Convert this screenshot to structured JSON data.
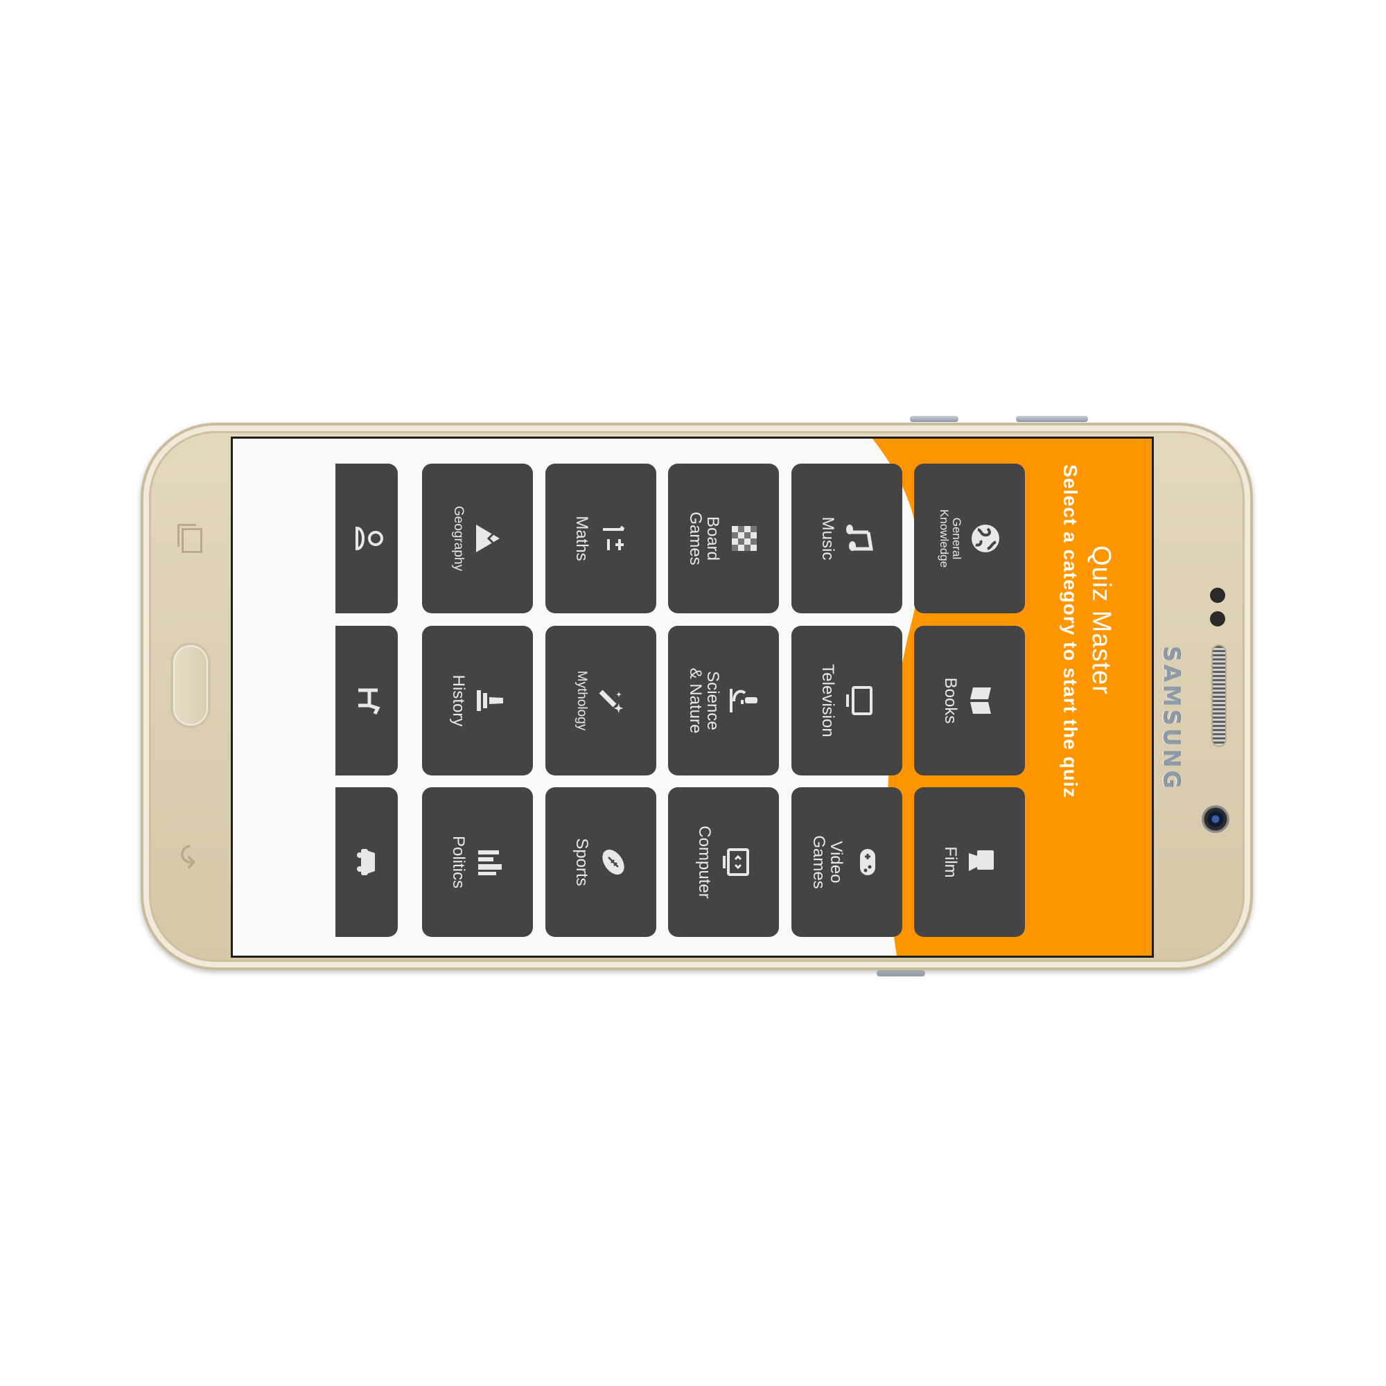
{
  "device": {
    "brand": "SAMSUNG",
    "body_color": "#dccfb2"
  },
  "app": {
    "title": "Quiz Master",
    "subtitle": "Select a category to start the quiz",
    "accent_color": "#ff9500",
    "tile_color": "#444444"
  },
  "categories": [
    {
      "label": "General\nKnowledge",
      "icon": "globe-icon"
    },
    {
      "label": "Books",
      "icon": "book-icon"
    },
    {
      "label": "Film",
      "icon": "film-camera-icon"
    },
    {
      "label": "Music",
      "icon": "music-note-icon"
    },
    {
      "label": "Television",
      "icon": "tv-icon"
    },
    {
      "label": "Video\nGames",
      "icon": "gamepad-icon"
    },
    {
      "label": "Board\nGames",
      "icon": "chessboard-icon"
    },
    {
      "label": "Science\n& Nature",
      "icon": "microscope-icon"
    },
    {
      "label": "Computer",
      "icon": "computer-icon"
    },
    {
      "label": "Maths",
      "icon": "numbers-icon"
    },
    {
      "label": "Mythology",
      "icon": "magic-wand-icon"
    },
    {
      "label": "Sports",
      "icon": "football-icon"
    },
    {
      "label": "Geography",
      "icon": "mountain-icon"
    },
    {
      "label": "History",
      "icon": "monument-icon"
    },
    {
      "label": "Politics",
      "icon": "parliament-icon"
    },
    {
      "label": "",
      "icon": "person-icon"
    },
    {
      "label": "",
      "icon": "animal-icon"
    },
    {
      "label": "",
      "icon": "car-icon"
    }
  ]
}
